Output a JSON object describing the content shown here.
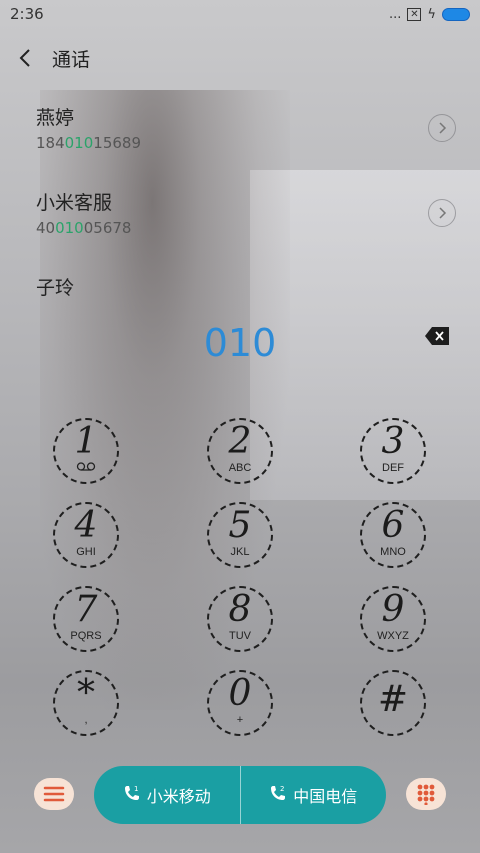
{
  "status_bar": {
    "time": "2:36",
    "dots": "..."
  },
  "header": {
    "title": "通话"
  },
  "contacts": [
    {
      "name": "燕婷",
      "number_pre": "184",
      "number_hl": "010",
      "number_post": "15689"
    },
    {
      "name": "小米客服",
      "number_pre": "40",
      "number_hl": "010",
      "number_post": "05678"
    },
    {
      "name": "子玲"
    }
  ],
  "dialer": {
    "input": "010"
  },
  "keys": [
    {
      "digit": "1",
      "letters": ""
    },
    {
      "digit": "2",
      "letters": "ABC"
    },
    {
      "digit": "3",
      "letters": "DEF"
    },
    {
      "digit": "4",
      "letters": "GHI"
    },
    {
      "digit": "5",
      "letters": "JKL"
    },
    {
      "digit": "6",
      "letters": "MNO"
    },
    {
      "digit": "7",
      "letters": "PQRS"
    },
    {
      "digit": "8",
      "letters": "TUV"
    },
    {
      "digit": "9",
      "letters": "WXYZ"
    },
    {
      "digit": "*",
      "letters": ","
    },
    {
      "digit": "0",
      "letters": "+"
    },
    {
      "digit": "#",
      "letters": ""
    }
  ],
  "call_buttons": {
    "sim1_label": "小米移动",
    "sim2_label": "中国电信"
  },
  "colors": {
    "accent": "#2d8bd6",
    "call_pill": "#1a9fa3",
    "highlight": "#2ba36a",
    "side_btn": "#f7e3d6",
    "side_icon": "#e05a3a"
  },
  "icons": {
    "back": "chevron-left-icon",
    "detail": "chevron-right-circle-icon",
    "backspace": "backspace-icon",
    "menu": "menu-icon",
    "keypad_toggle": "dialpad-icon",
    "voicemail": "voicemail-icon",
    "sim1": "phone-sim1-icon",
    "sim2": "phone-sim2-icon"
  }
}
